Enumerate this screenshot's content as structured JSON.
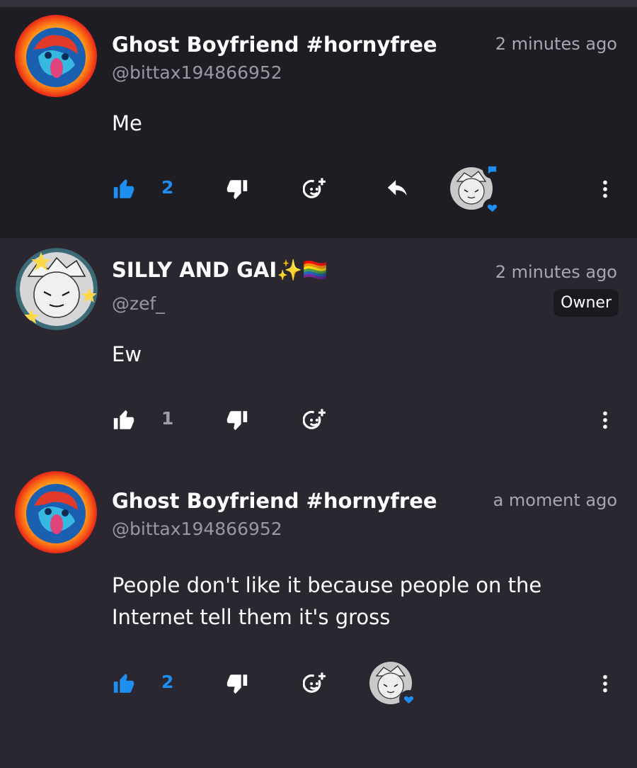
{
  "comments": [
    {
      "username": "Ghost Boyfriend #hornyfree",
      "handle": "@bittax194866952",
      "time": "2 minutes ago",
      "text": "Me",
      "likes": "2",
      "liked": true
    },
    {
      "username": "SILLY AND GAI✨🏳️‍🌈",
      "handle": "@zef_",
      "time": "2 minutes ago",
      "badge": "Owner",
      "text": "Ew",
      "likes": "1",
      "liked": false
    },
    {
      "username": "Ghost Boyfriend #hornyfree",
      "handle": "@bittax194866952",
      "time": "a moment ago",
      "text": "People don't like it because people on the\nInternet tell them it's gross",
      "likes": "2",
      "liked": true
    }
  ],
  "colors": {
    "accent": "#1e8ef0",
    "bg_highlight": "#1f1d24",
    "bg": "#2a2731",
    "muted": "#9a97a3"
  },
  "icons": [
    "thumbs-up-icon",
    "thumbs-down-icon",
    "add-reaction-icon",
    "reply-icon",
    "more-vertical-icon",
    "heart-icon",
    "chat-bubble-icon"
  ]
}
